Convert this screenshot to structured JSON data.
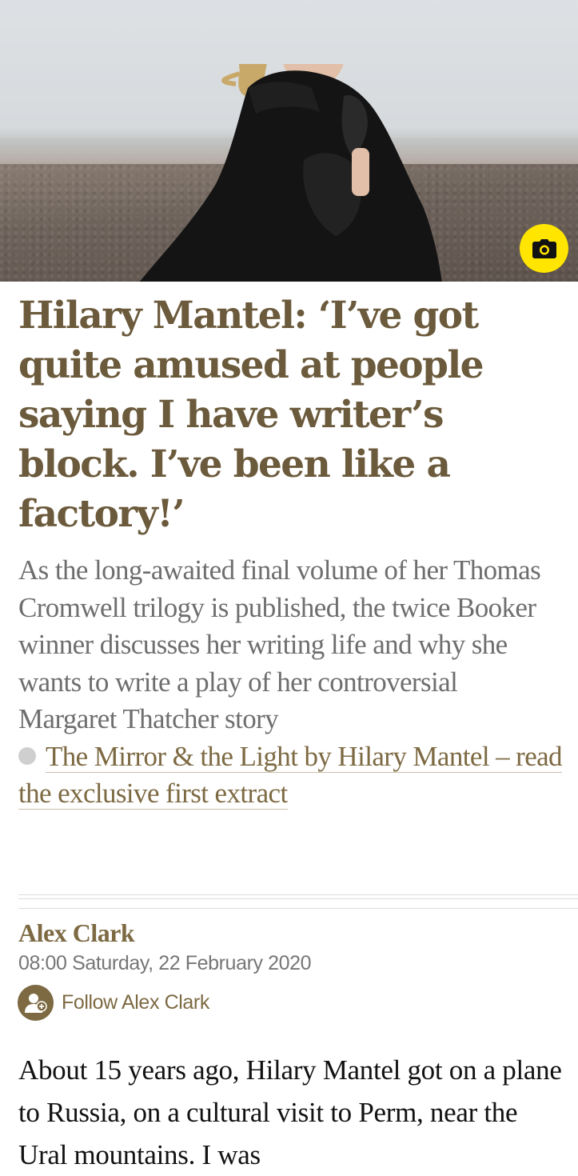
{
  "hero": {
    "image_icon": "portrait-photo",
    "camera_icon": "camera-icon",
    "accent_color": "#ffe500"
  },
  "article": {
    "headline": "Hilary Mantel: ‘I’ve got quite amused at people saying I have writer’s block. I’ve been like a factory!’",
    "standfirst": "As the long-awaited final volume of her Thomas Cromwell trilogy is published, the twice Booker winner discusses her writing life and why she wants to write a play of her controversial Margaret Thatcher story",
    "related_link": "The Mirror & the Light by Hilary Mantel – read the exclusive first extract",
    "author": "Alex Clark",
    "dateline": "08:00 Saturday, 22 February 2020",
    "follow_label": "Follow Alex Clark",
    "body_first_paragraph": "About 15 years ago, Hilary Mantel got on a plane to Russia, on a cultural visit to Perm, near the Ural mountains. I was"
  },
  "colors": {
    "headline": "#6b5a3b",
    "link": "#7d6a43",
    "standfirst": "#6e6e6e",
    "body": "#121212"
  }
}
